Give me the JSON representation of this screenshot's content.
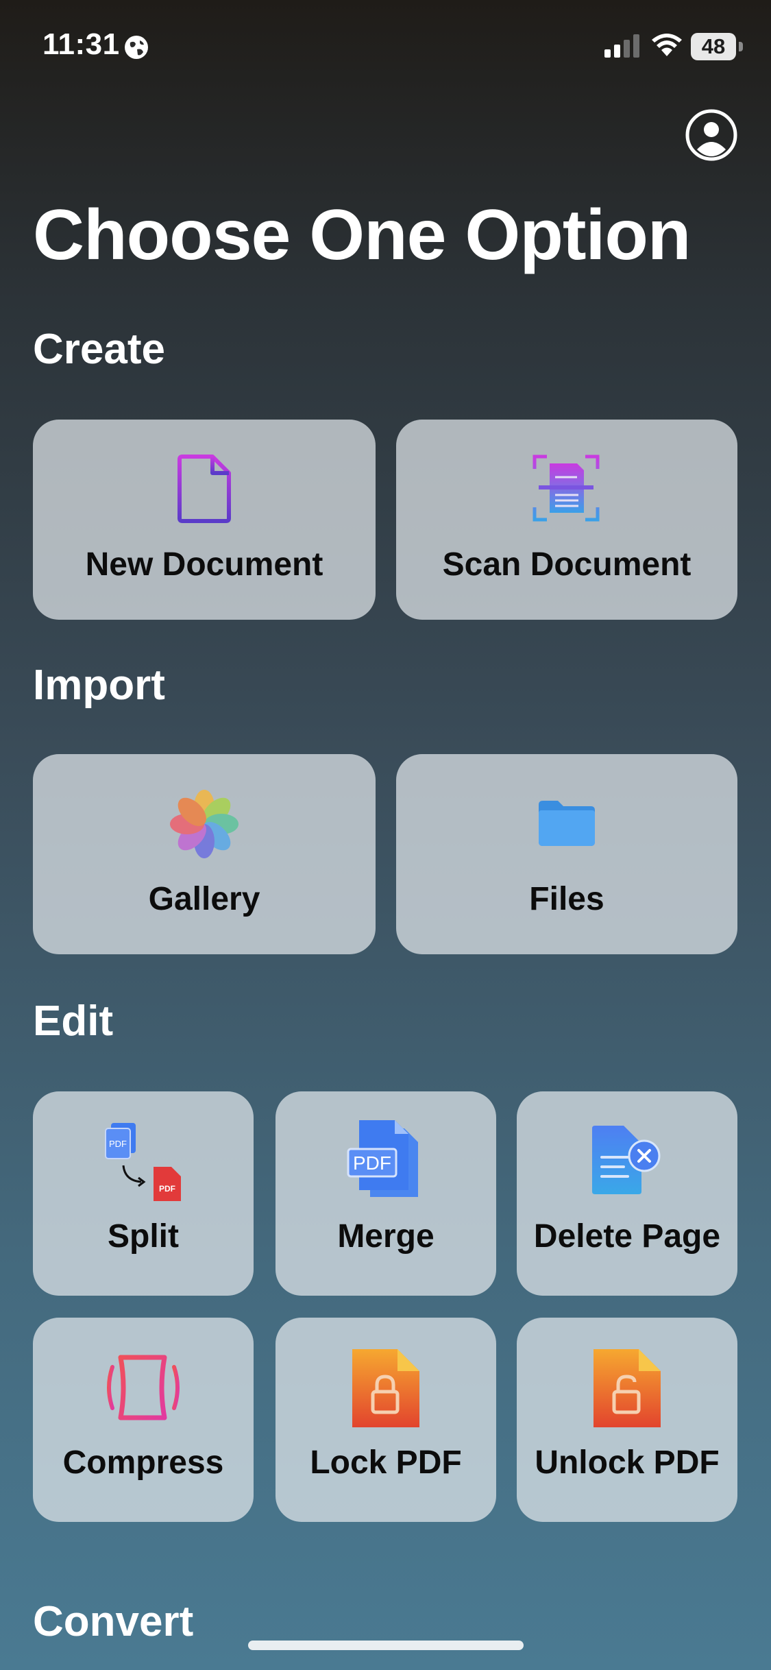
{
  "status_bar": {
    "time": "11:31",
    "battery": "48"
  },
  "header": {
    "title": "Choose One Option"
  },
  "sections": {
    "create": {
      "title": "Create",
      "new_document": "New Document",
      "scan_document": "Scan Document"
    },
    "import": {
      "title": "Import",
      "gallery": "Gallery",
      "files": "Files"
    },
    "edit": {
      "title": "Edit",
      "split": "Split",
      "merge": "Merge",
      "delete_page": "Delete Page",
      "compress": "Compress",
      "lock_pdf": "Lock PDF",
      "unlock_pdf": "Unlock PDF"
    },
    "convert": {
      "title": "Convert"
    }
  },
  "icon_text": {
    "pdf": "PDF"
  },
  "icons": [
    "globe-icon",
    "signal-icon",
    "wifi-icon",
    "battery-icon",
    "account-icon",
    "new-document-icon",
    "scan-document-icon",
    "gallery-icon",
    "files-icon",
    "split-icon",
    "merge-icon",
    "delete-page-icon",
    "compress-icon",
    "lock-pdf-icon",
    "unlock-pdf-icon"
  ],
  "colors": {
    "accent_purple": "#b03ad8",
    "accent_blue": "#3f7bf0",
    "pdf_red": "#e23a3a",
    "lock_orange": "#f29a2e"
  }
}
